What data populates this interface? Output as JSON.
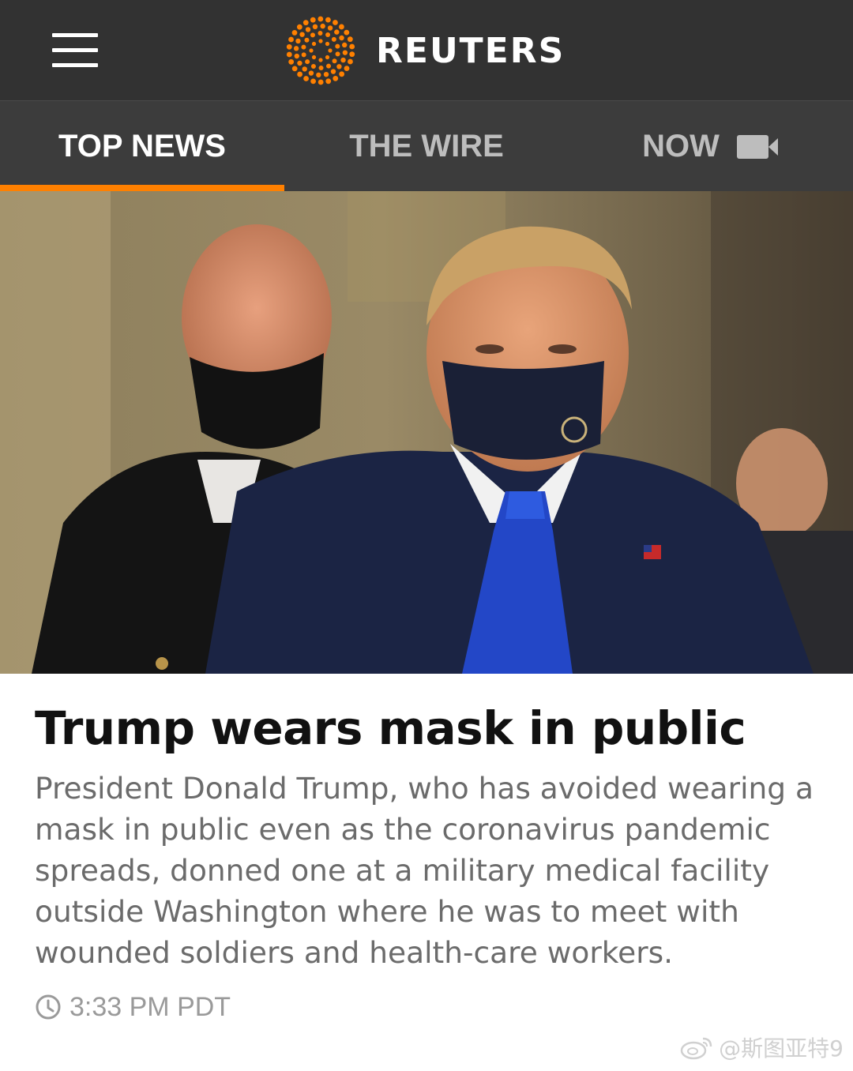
{
  "header": {
    "brand_name": "REUTERS",
    "menu_icon": "hamburger-menu-icon",
    "logo_icon": "reuters-dot-logo",
    "accent_color": "#ff8000"
  },
  "tabs": [
    {
      "label": "TOP NEWS",
      "active": true
    },
    {
      "label": "THE WIRE",
      "active": false
    },
    {
      "label": "NOW",
      "active": false,
      "icon": "video-camera-icon"
    }
  ],
  "article": {
    "headline": "Trump wears mask in public",
    "summary": "President Donald Trump, who has avoided wearing a mask in public even as the coronavirus pandemic spreads, donned one at a military medical facility outside Washington where he was to meet with wounded soldiers and health-care workers.",
    "time": "3:33 PM PDT",
    "time_icon": "clock-icon"
  },
  "watermark": {
    "text": "@斯图亚特9",
    "icon": "weibo-icon"
  }
}
